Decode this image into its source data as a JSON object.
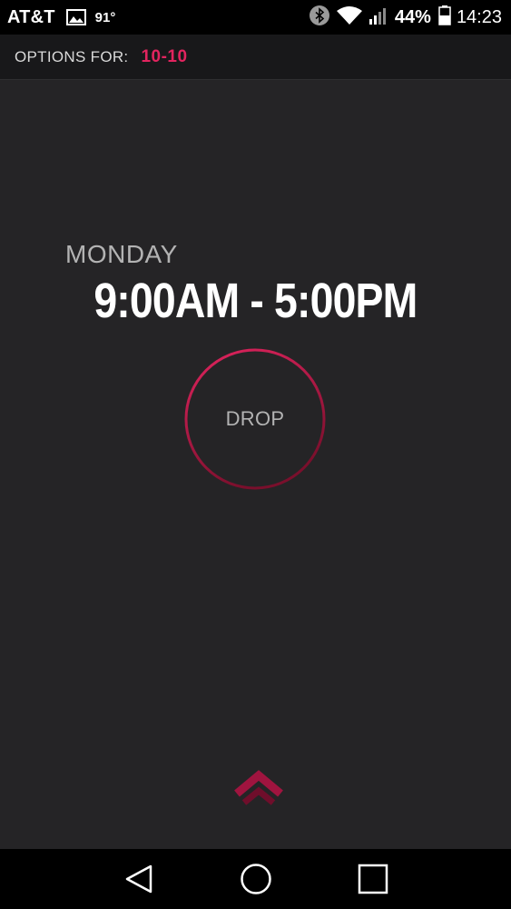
{
  "status_bar": {
    "carrier": "AT&T",
    "temperature": "91°",
    "battery_percent": "44%",
    "time": "14:23",
    "icons": [
      "gallery-icon",
      "bluetooth-icon",
      "wifi-icon",
      "signal-icon",
      "battery-icon"
    ]
  },
  "options": {
    "label": "OPTIONS FOR:",
    "value": "10-10"
  },
  "shift": {
    "day": "MONDAY",
    "time_range": "9:00AM - 5:00PM"
  },
  "actions": {
    "drop_label": "DROP"
  },
  "navigation": [
    "back-icon",
    "home-icon",
    "recents-icon"
  ],
  "colors": {
    "accent": "#e2245f",
    "accent_dark": "#7a0f2c",
    "background": "#252426",
    "header": "#18181a",
    "muted_text": "#b3b3b3"
  }
}
